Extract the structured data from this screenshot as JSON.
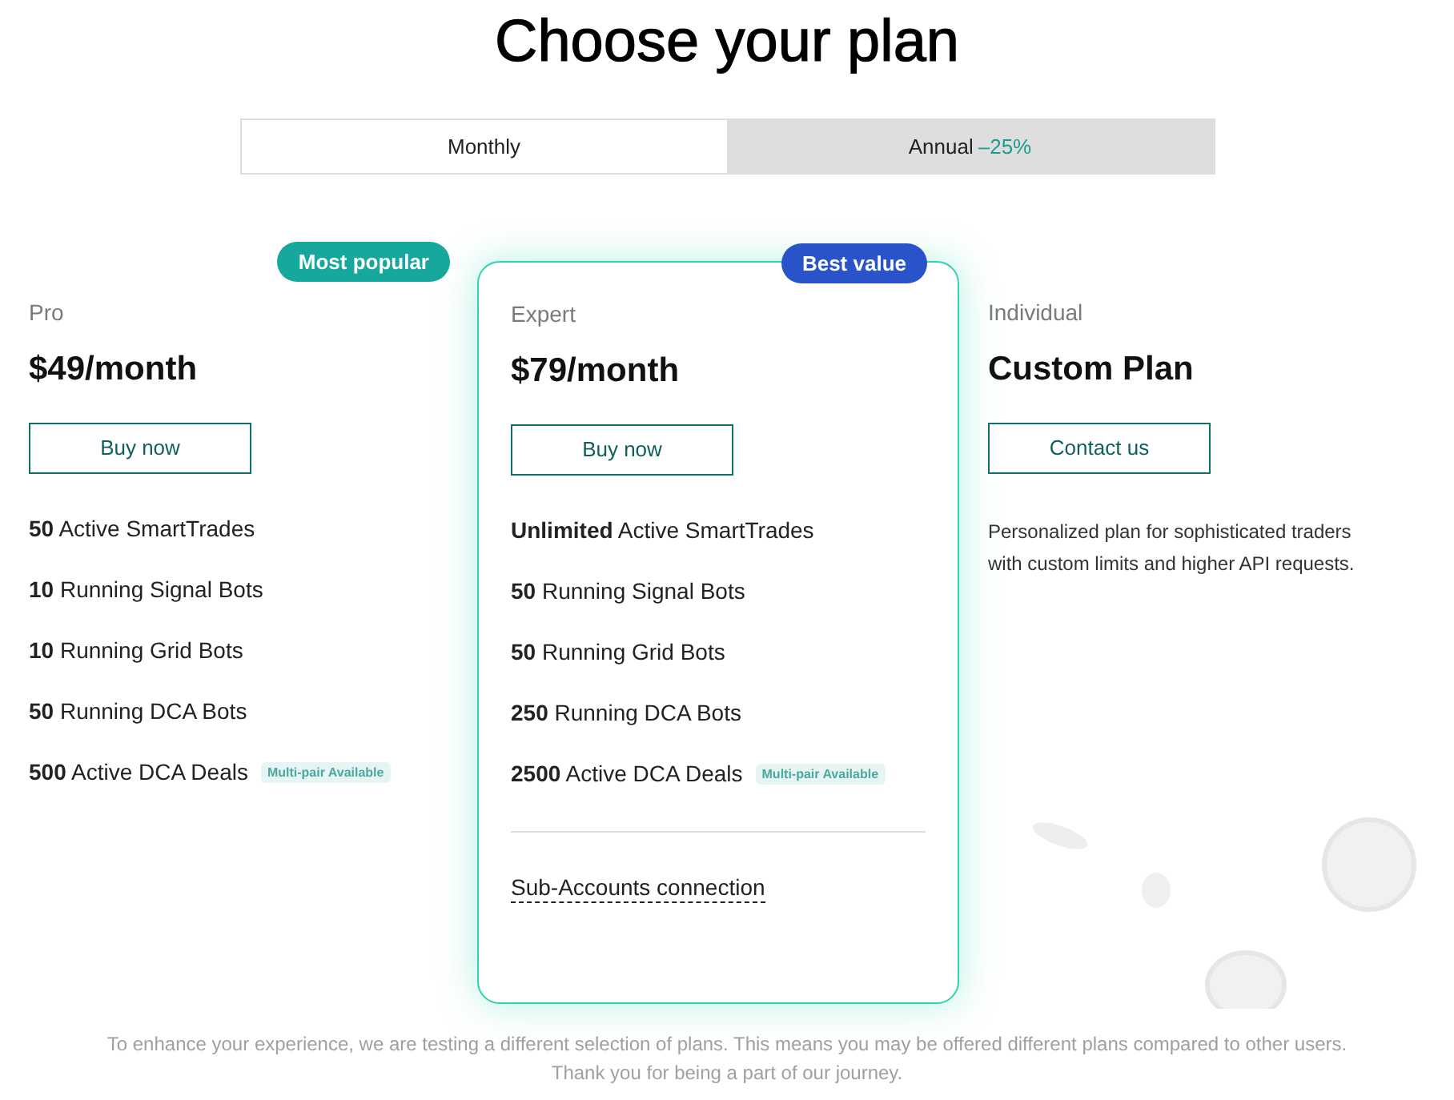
{
  "title": "Choose your plan",
  "billing_tabs": [
    {
      "label": "Monthly",
      "selected": true
    },
    {
      "label": "Annual",
      "discount": "–25%",
      "selected": false
    }
  ],
  "plans": [
    {
      "kind": "priced",
      "highlighted": false,
      "badge": {
        "label": "Most popular",
        "color": "#16a89c"
      },
      "tier": "Pro",
      "price": "$49/month",
      "button": "Buy now",
      "features": [
        {
          "text": "**50** Active SmartTrades"
        },
        {
          "text": "**10** Running Signal Bots"
        },
        {
          "text": "**10** Running Grid Bots"
        },
        {
          "text": "**50** Running DCA Bots"
        },
        {
          "text": "**500** Active DCA Deals",
          "tag": "Multi-pair Available"
        }
      ]
    },
    {
      "kind": "priced",
      "highlighted": true,
      "badge": {
        "label": "Best value",
        "color": "#2a52c9"
      },
      "tier": "Expert",
      "price": "$79/month",
      "button": "Buy now",
      "features": [
        {
          "text": "**Unlimited** Active SmartTrades"
        },
        {
          "text": "**50** Running Signal Bots"
        },
        {
          "text": "**50** Running Grid Bots"
        },
        {
          "text": "**250** Running DCA Bots"
        },
        {
          "text": "**2500** Active DCA Deals",
          "tag": "Multi-pair Available"
        }
      ],
      "extra_link": "Sub-Accounts connection"
    },
    {
      "kind": "custom",
      "highlighted": false,
      "tier": "Individual",
      "price": "Custom Plan",
      "button": "Contact us",
      "description": "Personalized plan for sophisticated traders with custom limits and higher API requests."
    }
  ],
  "footer_note": [
    "To enhance your experience, we are testing a different selection of plans. This means you may be offered different plans compared to other users.",
    "Thank you for being a part of our journey."
  ]
}
